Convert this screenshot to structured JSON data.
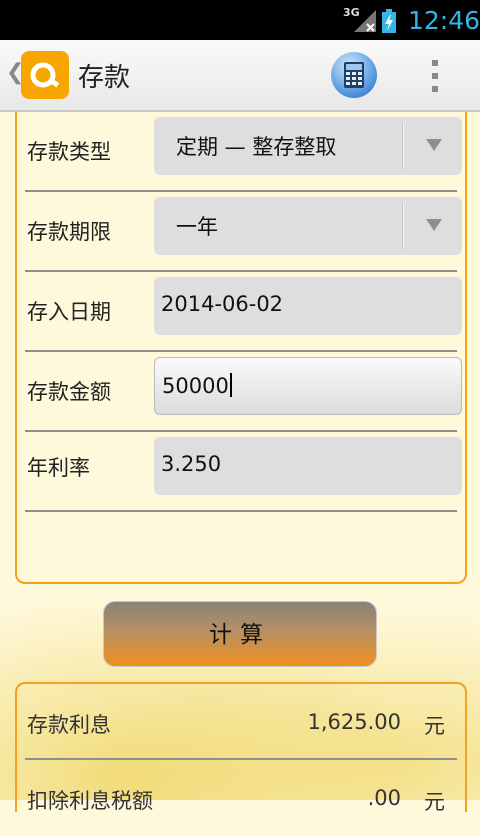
{
  "status": {
    "network": "3G",
    "time": "12:46"
  },
  "actionbar": {
    "title": "存款",
    "back_glyph": "❮",
    "logo_icon": "app-logo-icon",
    "calc_icon": "calculator-icon",
    "menu_icon": "overflow-menu-icon"
  },
  "form": {
    "deposit_type": {
      "label": "存款类型",
      "value": "定期 — 整存整取"
    },
    "deposit_term": {
      "label": "存款期限",
      "value": "一年"
    },
    "deposit_date": {
      "label": "存入日期",
      "value": "2014-06-02"
    },
    "deposit_amount": {
      "label": "存款金额",
      "value": "50000"
    },
    "annual_rate": {
      "label": "年利率",
      "value": "3.250"
    }
  },
  "calc_button": {
    "label": "计算"
  },
  "results": [
    {
      "label": "存款利息",
      "value": "1,625.00",
      "unit": "元"
    },
    {
      "label": "扣除利息税额",
      "value": ".00",
      "unit": "元"
    }
  ],
  "colors": {
    "accent": "#f5a01f",
    "logo": "#f7a600",
    "statusbar_text": "#33b5e5"
  }
}
